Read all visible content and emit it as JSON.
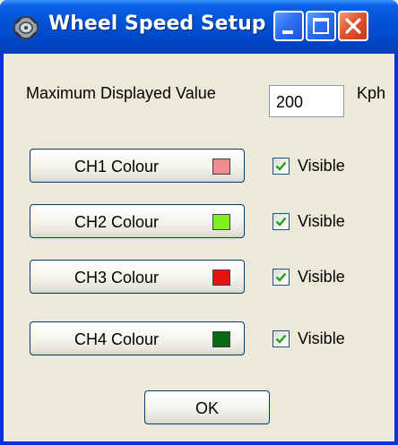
{
  "window": {
    "title": "Wheel Speed Setup",
    "icon": "wheel-icon",
    "controls": [
      "minimize-icon",
      "maximize-icon",
      "close-icon"
    ]
  },
  "max_value": {
    "label": "Maximum Displayed Value",
    "value": "200",
    "unit": "Kph"
  },
  "channels": [
    {
      "label": "CH1 Colour",
      "color": "#f08c8c",
      "visible_label": "Visible",
      "visible": true
    },
    {
      "label": "CH2 Colour",
      "color": "#80f020",
      "visible_label": "Visible",
      "visible": true
    },
    {
      "label": "CH3 Colour",
      "color": "#e81010",
      "visible_label": "Visible",
      "visible": true
    },
    {
      "label": "CH4 Colour",
      "color": "#0a6a14",
      "visible_label": "Visible",
      "visible": true
    }
  ],
  "ok_label": "OK"
}
